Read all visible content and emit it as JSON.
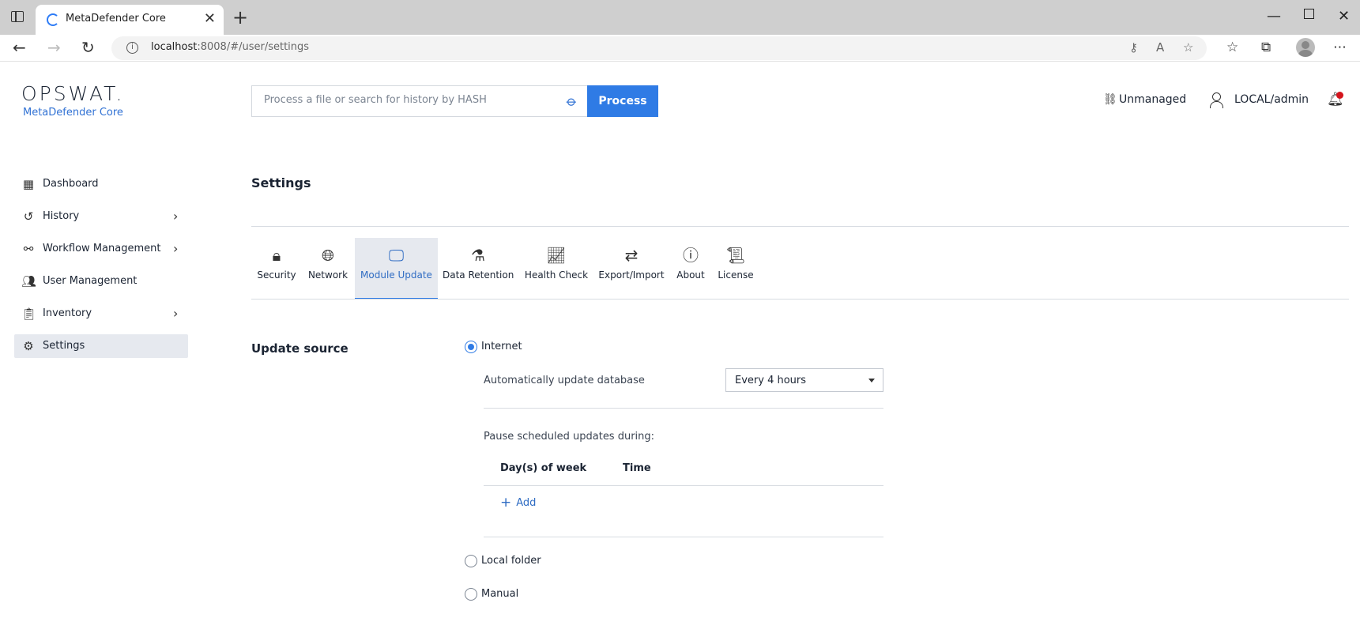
{
  "browser": {
    "tab_title": "MetaDefender Core",
    "url_host": "localhost",
    "url_rest": ":8008/#/user/settings"
  },
  "header": {
    "logo": "OPSWAT.",
    "product": "MetaDefender Core",
    "search_placeholder": "Process a file or search for history by HASH",
    "process_label": "Process",
    "unmanaged_label": "Unmanaged",
    "user_label": "LOCAL/admin"
  },
  "sidebar": {
    "items": [
      {
        "label": "Dashboard",
        "icon": "grid-icon"
      },
      {
        "label": "History",
        "icon": "history-icon"
      },
      {
        "label": "Workflow Management",
        "icon": "workflow-icon"
      },
      {
        "label": "User Management",
        "icon": "users-icon"
      },
      {
        "label": "Inventory",
        "icon": "clipboard-icon"
      },
      {
        "label": "Settings",
        "icon": "gear-icon"
      }
    ]
  },
  "main": {
    "title": "Settings",
    "tabs": [
      {
        "label": "Security"
      },
      {
        "label": "Network"
      },
      {
        "label": "Module Update"
      },
      {
        "label": "Data Retention"
      },
      {
        "label": "Health Check"
      },
      {
        "label": "Export/Import"
      },
      {
        "label": "About"
      },
      {
        "label": "License"
      }
    ],
    "update_source": {
      "label": "Update source",
      "options": [
        "Internet",
        "Local folder",
        "Manual"
      ],
      "auto_update_label": "Automatically update database",
      "auto_update_value": "Every 4 hours",
      "pause_label": "Pause scheduled updates during:",
      "table_headers": [
        "Day(s) of week",
        "Time"
      ],
      "add_label": "Add"
    }
  }
}
